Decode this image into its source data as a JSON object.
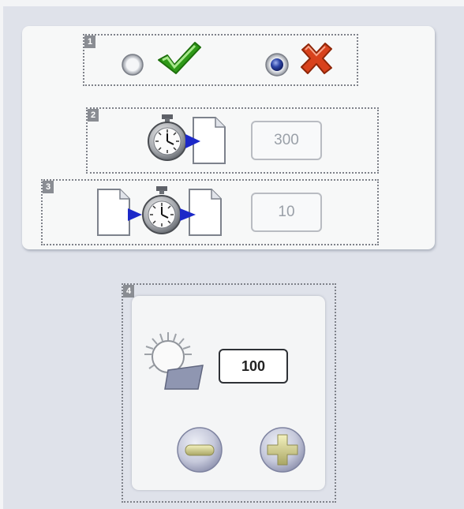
{
  "zone1": {
    "badge": "1",
    "radio_yes": "unselected",
    "radio_no": "selected",
    "yes_icon": "green-check-icon",
    "no_icon": "red-x-icon"
  },
  "zone2": {
    "badge": "2",
    "icon": "timer-to-document-icon",
    "value": "300"
  },
  "zone3": {
    "badge": "3",
    "icon": "document-timer-document-icon",
    "value": "10"
  },
  "zone4": {
    "badge": "4",
    "icon": "brightness-sun-icon",
    "value": "100",
    "decrease_icon": "minus-icon",
    "increase_icon": "plus-icon"
  },
  "colors": {
    "background": "#dfe2ea",
    "panel": "#f7f8f8",
    "check": "#2f9a18",
    "cross": "#d8421c",
    "arrow": "#1c28c8"
  }
}
